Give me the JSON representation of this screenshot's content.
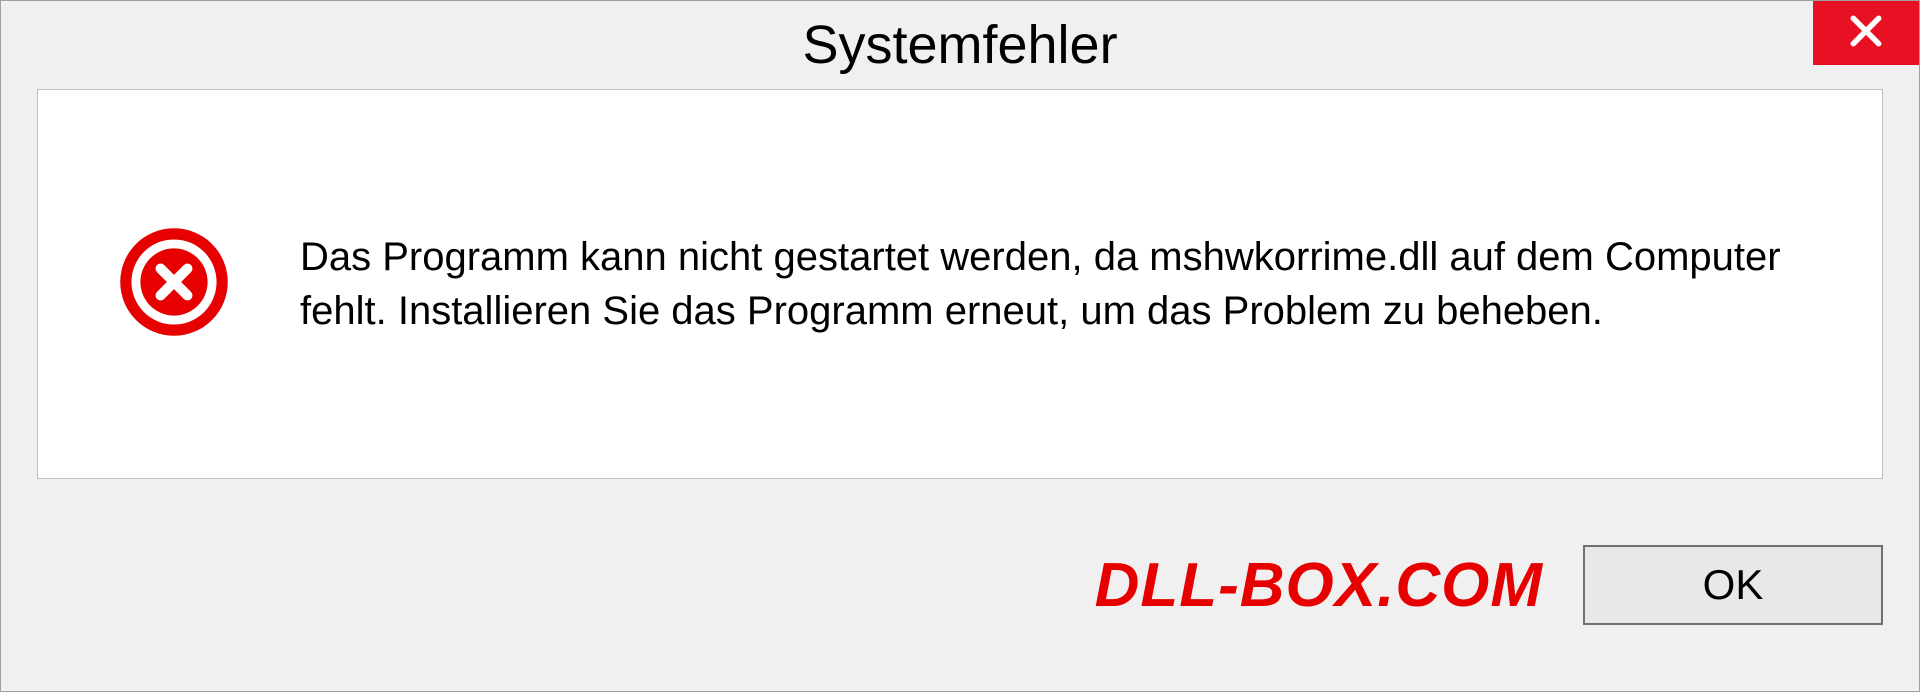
{
  "dialog": {
    "title": "Systemfehler",
    "message": "Das Programm kann nicht gestartet werden, da mshwkorrime.dll auf dem Computer fehlt. Installieren Sie das Programm erneut, um das Problem zu beheben.",
    "ok_label": "OK",
    "watermark": "DLL-BOX.COM"
  },
  "colors": {
    "close_bg": "#e81123",
    "error_icon": "#e60000",
    "watermark": "#e60000"
  }
}
